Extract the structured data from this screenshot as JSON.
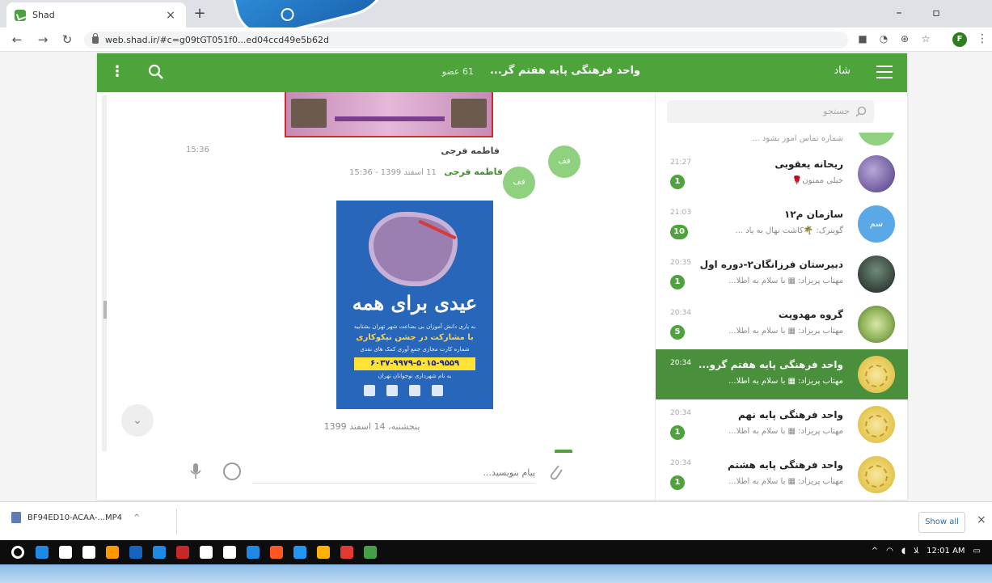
{
  "browser": {
    "tab_title": "Shad",
    "tab_close": "×",
    "new_tab": "+",
    "url": "web.shad.ir/#c=g09tGT051f0...ed04ccd49e5b62d",
    "profile_initial": "F",
    "window_controls": {
      "minimize": "–",
      "maximize": "▫",
      "close": "×"
    }
  },
  "app": {
    "name": "شاد",
    "chat_title": "واحد فرهنگی پایه هفتم گر...",
    "member_count": "61 عضو",
    "accent_color": "#4ca43b",
    "selected_color": "#4a8f3b"
  },
  "chat": {
    "message_time": "15:36",
    "sender": "فاطمه فرجی",
    "avatar_label": "فف",
    "forward_name": "فاطمه فرجی",
    "forward_meta": "11 اسفند 1399 - 15:36",
    "poster": {
      "headline": "عیدی برای همه",
      "line1": "به یاری دانش آموزان بی بضاعت شهر تهران بشتابید",
      "line2": "با مشارکت در جشن نیکوکاری",
      "line3": "شماره کارت مجازی جمع آوری کمک های نقدی",
      "phone": "۶۰۳۷-۹۹۷۹-۵۰۱۵-۹۵۵۹",
      "line4": "به نام شهرداری نوجوانان تهران"
    },
    "date_separator": "پنجشنبه، 14 اسفند 1399",
    "scroll_down": "⌄",
    "composer_placeholder": "پیام بنویسید..."
  },
  "sidebar": {
    "search_placeholder": "جستجو",
    "partial_preview": "شماره تماس امور بشود ...",
    "items": [
      {
        "name": "ریحانه یعقوبی",
        "preview": "خیلی ممنون🌹",
        "time": "21:27",
        "badge": "1",
        "avatar": "photo-purple"
      },
      {
        "name": "سازمان م۱۲",
        "preview": "گوینرک: 🌴کاشت نهال به یاد ...",
        "time": "21:03",
        "badge": "10",
        "avatar": "initials",
        "avatar_label": "سم"
      },
      {
        "name": "دبیرستان فرزانگان۲-دوره اول",
        "preview": "مهتاب پریزاد: ▦ با سلام به اطلا...",
        "time": "20:35",
        "badge": "1",
        "avatar": "photo-dark"
      },
      {
        "name": "گروه مهدویت",
        "preview": "مهتاب پریزاد: ▦ با سلام به اطلا...",
        "time": "20:34",
        "badge": "5",
        "avatar": "photo-green"
      },
      {
        "name": "واحد فرهنگی پایه هفتم گرو...",
        "preview": "مهتاب پریزاد: ▦ با سلام به اطلا...",
        "time": "20:34",
        "badge": "",
        "avatar": "emblem",
        "active": true
      },
      {
        "name": "واحد فرهنگی پایه نهم",
        "preview": "مهتاب پریزاد: ▦ با سلام به اطلا...",
        "time": "20:34",
        "badge": "1",
        "avatar": "emblem"
      },
      {
        "name": "واحد فرهنگی پایه هشتم",
        "preview": "مهتاب پریزاد: ▦ با سلام به اطلا...",
        "time": "20:34",
        "badge": "1",
        "avatar": "emblem"
      }
    ]
  },
  "downloads": {
    "file_name": "BF94ED10-ACAA-...MP4",
    "show_all": "Show all",
    "close": "×"
  },
  "taskbar": {
    "clock": "12:01 AM",
    "tray_lang": "ﻼ",
    "app_colors": [
      "#1e88e5",
      "#ffffff",
      "#ffffff",
      "#ff9800",
      "#1565c0",
      "#1e88e5",
      "#c62828",
      "#ffffff",
      "#ffffff",
      "#1e88e5",
      "#ff5722",
      "#2196f3",
      "#ffb300",
      "#e53935",
      "#43a047"
    ]
  }
}
